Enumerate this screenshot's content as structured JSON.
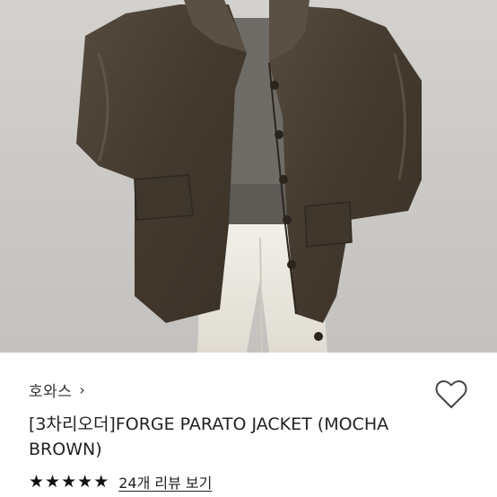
{
  "product": {
    "image_alt": "Model wearing brown leather jacket with grey knit sweater and white pants",
    "brand": "호와스",
    "brand_chevron": "›",
    "title": "[3차리오더]FORGE PARATO JACKET (MOCHA BROWN)",
    "rating_stars": 5,
    "reviews_link": "24개 리뷰 보기"
  },
  "icons": {
    "favorite": "heart-outline-icon",
    "brand_link": "chevron-right-icon",
    "rating": "star-icon"
  },
  "colors": {
    "jacket": "#4a4236",
    "sweater": "#6f6c67",
    "pants": "#ece9e2",
    "background": "#cfcdc9",
    "star": "#111111"
  }
}
